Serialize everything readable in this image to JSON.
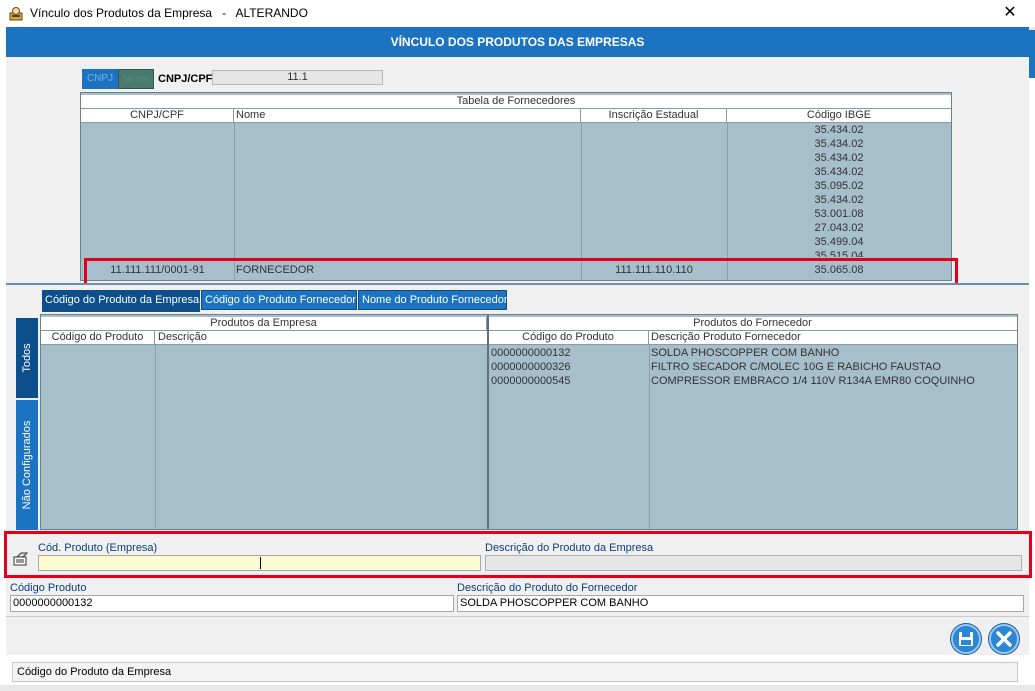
{
  "window": {
    "title": "Vínculo dos Produtos da Empresa   -   ALTERANDO",
    "close_glyph": "✕"
  },
  "header": {
    "title": "VÍNCULO DOS PRODUTOS DAS EMPRESAS"
  },
  "filter": {
    "tab_cnpj": "CNPJ",
    "tab_nome": "Nome",
    "cnpj_label": "CNPJ/CPF",
    "cnpj_value": "11.1"
  },
  "suppliers_table": {
    "caption": "Tabela de Fornecedores",
    "columns": [
      "CNPJ/CPF",
      "Nome",
      "Inscrição Estadual",
      "Código IBGE"
    ],
    "ibge_codes": [
      "35.434.02",
      "35.434.02",
      "35.434.02",
      "35.434.02",
      "35.095.02",
      "35.434.02",
      "53.001.08",
      "27.043.02",
      "35.499.04",
      "35.515.04"
    ],
    "selected_row": {
      "cnpj": "11.111.111/0001-91",
      "nome": "FORNECEDOR",
      "ie": "111.111.110.110",
      "ibge": "35.065.08"
    }
  },
  "tabs": {
    "cod_emp": "Código do Produto da Empresa",
    "cod_forn": "Código do Produto Fornecedor",
    "nome_forn": "Nome do Produto Fornecedor"
  },
  "side_tabs": {
    "todos": "Todos",
    "nao_configurados": "Não Configurados"
  },
  "products_table": {
    "left_caption": "Produtos da Empresa",
    "right_caption": "Produtos do Fornecedor",
    "left_columns": [
      "Código do Produto",
      "Descrição"
    ],
    "right_columns": [
      "Código do Produto",
      "Descrição Produto Fornecedor"
    ],
    "rows": [
      {
        "code": "0000000000132",
        "desc": "SOLDA PHOSCOPPER COM BANHO"
      },
      {
        "code": "0000000000326",
        "desc": "FILTRO SECADOR C/MOLEC 10G E RABICHO FAUSTAO"
      },
      {
        "code": "0000000000545",
        "desc": "COMPRESSOR EMBRACO 1/4 110V R134A EMR80 COQUINHO"
      }
    ]
  },
  "form": {
    "cod_emp_label": "Cód. Produto (Empresa)",
    "desc_emp_label": "Descrição do Produto da Empresa",
    "cod_prod_label": "Código Produto",
    "cod_prod_value": "0000000000132",
    "desc_forn_label": "Descrição do Produto do Fornecedor",
    "desc_forn_value": "SOLDA PHOSCOPPER COM BANHO"
  },
  "status": {
    "text": "Código do Produto da Empresa"
  },
  "colors": {
    "accent": "#1b73c2",
    "grid_bg": "#a7becb",
    "highlight": "#e3001b",
    "input_yellow": "#fefbd3"
  }
}
